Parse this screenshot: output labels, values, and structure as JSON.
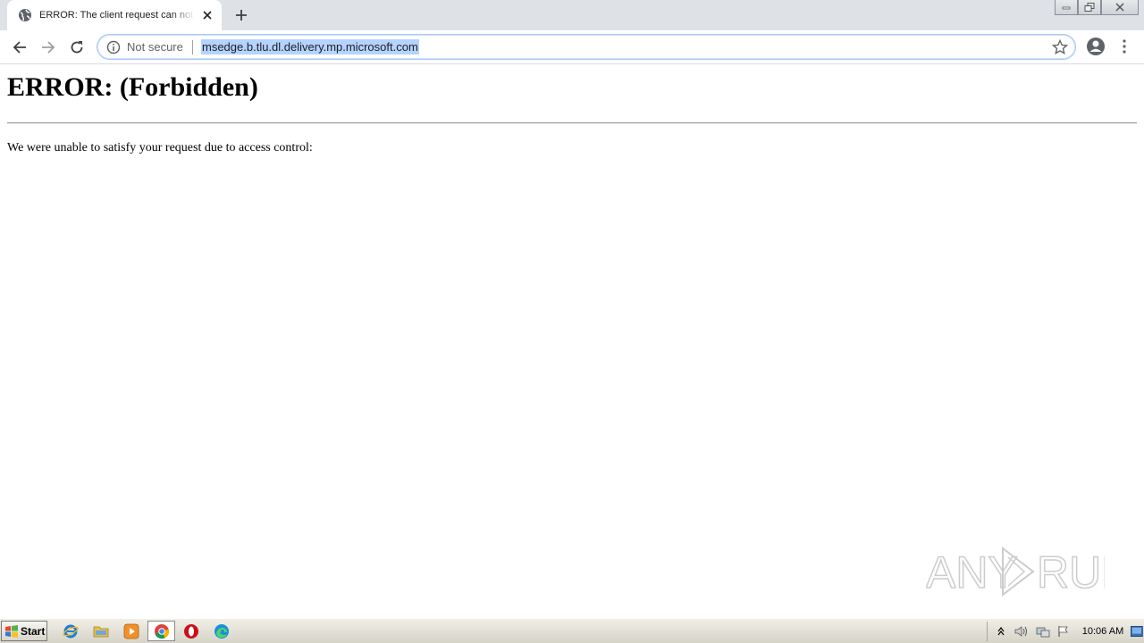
{
  "browser": {
    "tab": {
      "title": "ERROR: The client request can not be"
    },
    "omnibox": {
      "security_label": "Not secure",
      "url": "msedge.b.tlu.dl.delivery.mp.microsoft.com"
    }
  },
  "page": {
    "heading": "ERROR: (Forbidden)",
    "message": "We were unable to satisfy your request due to access control:"
  },
  "watermark": {
    "left_text": "ANY",
    "right_text": "RUN"
  },
  "taskbar": {
    "start_label": "Start",
    "pinned": [
      "internet-explorer-icon",
      "folder-icon",
      "media-player-icon",
      "chrome-icon",
      "opera-icon",
      "edge-icon"
    ],
    "clock": "10:06 AM"
  },
  "colors": {
    "tab_strip": "#dee1e6",
    "url_highlight": "#b5d3ff",
    "omnibox_border": "#a8c7fa"
  }
}
